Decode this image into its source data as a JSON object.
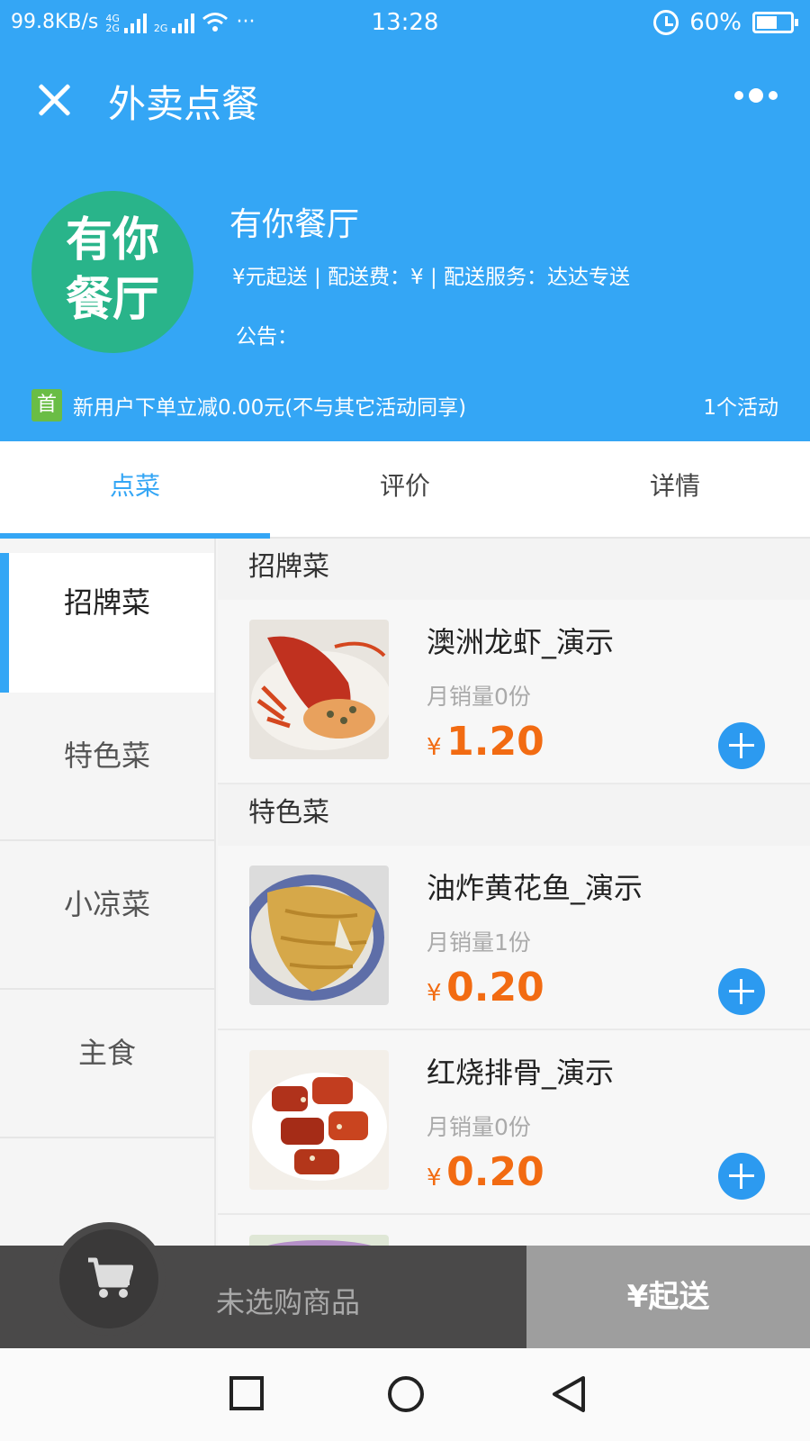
{
  "status_bar": {
    "net_speed": "99.8KB/s",
    "sim1_label": "4G\n2G",
    "sim2_label": "2G",
    "dots": "···",
    "time": "13:28",
    "battery_pct": "60%",
    "battery_level": 0.6
  },
  "header": {
    "title": "外卖点餐",
    "logo_line1": "有你",
    "logo_line2": "餐厅",
    "shop_name": "有你餐厅",
    "meta": "¥元起送 | 配送费：¥ | 配送服务：达达专送",
    "notice": "公告：",
    "promo_badge": "首",
    "promo_text": "新用户下单立减0.00元(不与其它活动同享)",
    "promo_count": "1个活动"
  },
  "tabs": [
    {
      "label": "点菜"
    },
    {
      "label": "评价"
    },
    {
      "label": "详情"
    }
  ],
  "categories": [
    {
      "label": "招牌菜"
    },
    {
      "label": "特色菜"
    },
    {
      "label": "小凉菜"
    },
    {
      "label": "主食"
    }
  ],
  "menu": {
    "sections": [
      {
        "title": "招牌菜",
        "dishes": [
          {
            "name": "澳洲龙虾_演示",
            "sales": "月销量0份",
            "currency": "¥",
            "price": "1.20"
          }
        ]
      },
      {
        "title": "特色菜",
        "dishes": [
          {
            "name": "油炸黄花鱼_演示",
            "sales": "月销量1份",
            "currency": "¥",
            "price": "0.20"
          },
          {
            "name": "红烧排骨_演示",
            "sales": "月销量0份",
            "currency": "¥",
            "price": "0.20"
          }
        ]
      }
    ]
  },
  "cart": {
    "empty_text": "未选购商品",
    "checkout_label": "¥起送"
  },
  "colors": {
    "brand": "#34a6f5",
    "price": "#f26b12",
    "logo": "#29b48a",
    "promo_badge": "#6abd45"
  }
}
